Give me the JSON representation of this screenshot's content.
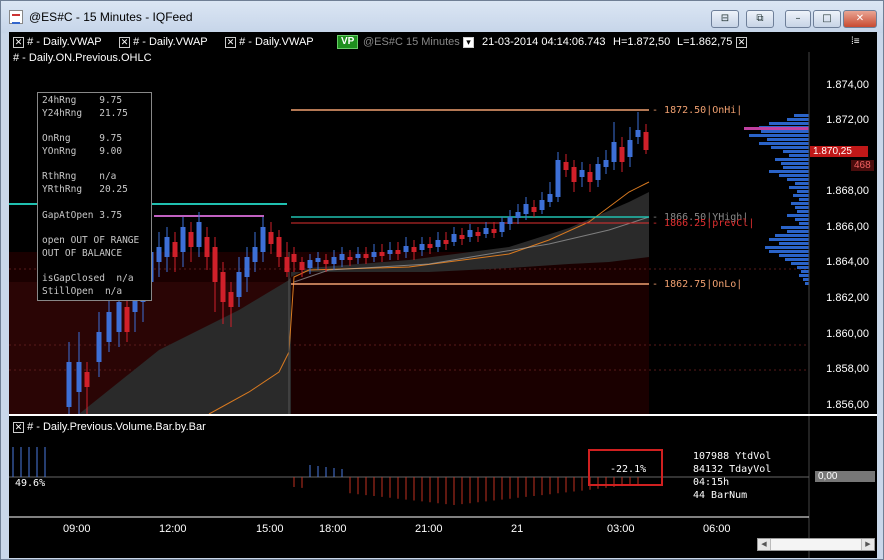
{
  "window": {
    "title": "@ES#C - 15 Minutes - IQFeed"
  },
  "toolbar": {
    "items": [
      "# - Daily.VWAP",
      "# - Daily.VWAP",
      "# - Daily.VWAP"
    ],
    "vp_badge": "VP",
    "symbol": "@ES#C  15 Minutes",
    "datetime": "21-03-2014   04:14:06.743",
    "high": "H=1.872,50",
    "low": "L=1.862,75"
  },
  "chart_subtitle": "# - Daily.ON.Previous.OHLC",
  "stats": [
    {
      "label": "24hRng",
      "value": "9.75"
    },
    {
      "label": "Y24hRng",
      "value": "21.75"
    },
    {
      "label": "OnRng",
      "value": "9.75"
    },
    {
      "label": "YOnRng",
      "value": "9.00"
    },
    {
      "label": "RthRng",
      "value": "n/a"
    },
    {
      "label": "YRthRng",
      "value": "20.25"
    },
    {
      "label": "GapAtOpen",
      "value": "3.75"
    }
  ],
  "stats_text": {
    "open_range": "open OUT OF RANGE",
    "balance": "OUT OF BALANCE",
    "gap_closed_label": "isGapClosed",
    "gap_closed_value": "n/a",
    "still_open_label": "StillOpen",
    "still_open_value": "n/a"
  },
  "levels": {
    "on_hi": "1872.50|OnHi|",
    "y_high": "1866.50|YHigh|",
    "prev_cl": "1866.25|prevCl|",
    "on_lo": "1862.75|OnLo|"
  },
  "price_axis": [
    "1.874,00",
    "1.872,00",
    "1.870,25",
    "1.868,00",
    "1.866,00",
    "1.864,00",
    "1.862,00",
    "1.860,00",
    "1.858,00",
    "1.856,00"
  ],
  "price_tag": "1.870,25",
  "volume_tag": "468",
  "lower_panel": {
    "title": "# - Daily.Previous.Volume.Bar.by.Bar",
    "left_pct": "49.6%",
    "highlight": "-22.1%",
    "ytd_vol": "107988 YtdVol",
    "tday_vol": "84132 TdayVol",
    "time": "04:15h",
    "bar_num": "44 BarNum",
    "zero_tag": "0,00"
  },
  "time_axis": [
    "09:00",
    "12:00",
    "15:00",
    "18:00",
    "21:00",
    "21",
    "03:00",
    "06:00"
  ],
  "colors": {
    "up": "#3d6fd6",
    "down": "#d0202a",
    "on_hi": "#f0a070",
    "y_high": "#20c0b0",
    "prev_cl": "#e03030",
    "vwap": "#d97a20"
  }
}
